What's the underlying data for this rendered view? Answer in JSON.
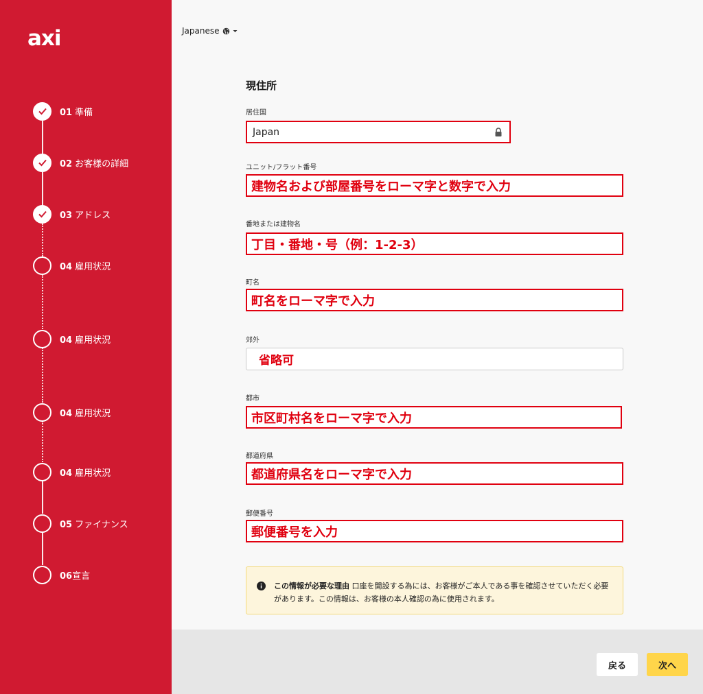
{
  "brand": {
    "logo": "axi",
    "color": "#d01a31"
  },
  "language": {
    "label": "Japanese",
    "icon": "globe-icon"
  },
  "steps": [
    {
      "num": "01",
      "label": "準備",
      "done": true
    },
    {
      "num": "02",
      "label": "お客様の詳細",
      "done": true
    },
    {
      "num": "03",
      "label": "アドレス",
      "done": true
    },
    {
      "num": "04",
      "label": "雇用状況",
      "done": false
    },
    {
      "num": "04",
      "label": "雇用状況",
      "done": false
    },
    {
      "num": "04",
      "label": "雇用状況",
      "done": false
    },
    {
      "num": "04",
      "label": "雇用状況",
      "done": false
    },
    {
      "num": "05",
      "label": "ファイナンス",
      "done": false
    },
    {
      "num": "06",
      "label": "宣言",
      "done": false
    }
  ],
  "form": {
    "title": "現住所",
    "country": {
      "label": "居住国",
      "value": "Japan"
    },
    "unit": {
      "label": "ユニット/フラット番号",
      "annotation": "建物名および部屋番号をローマ字と数字で入力"
    },
    "street": {
      "label": "番地または建物名",
      "annotation": "丁目・番地・号（例：1-2-3）"
    },
    "town": {
      "label": "町名",
      "annotation": "町名をローマ字で入力"
    },
    "suburb": {
      "label": "郊外",
      "annotation": "省略可"
    },
    "city": {
      "label": "都市",
      "annotation": "市区町村名をローマ字で入力"
    },
    "prefecture": {
      "label": "都道府県",
      "annotation": "都道府県名をローマ字で入力"
    },
    "postcode": {
      "label": "郵便番号",
      "annotation": "郵便番号を入力"
    }
  },
  "info": {
    "bold": "この情報が必要な理由",
    "text": "口座を開設する為には、お客様がご本人である事を確認させていただく必要があります。この情報は、お客様の本人確認の為に使用されます。"
  },
  "buttons": {
    "back": "戻る",
    "next": "次へ"
  }
}
